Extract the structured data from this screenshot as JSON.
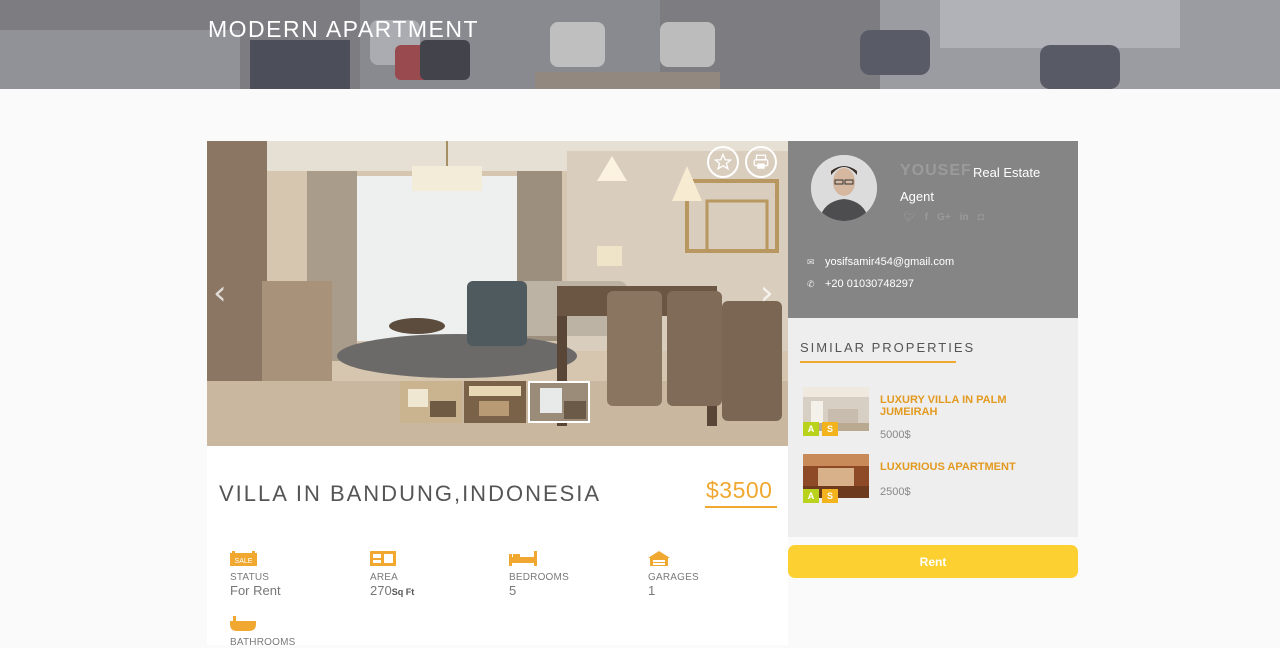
{
  "banner": {
    "title": "MODERN APARTMENT"
  },
  "gallery": {
    "prev_icon": "chevron-left-icon",
    "next_icon": "chevron-right-icon",
    "favorite_icon": "star-icon",
    "print_icon": "printer-icon",
    "thumbnail_count": 3,
    "active_thumbnail": 3
  },
  "property": {
    "title": "VILLA IN BANDUNG,INDONESIA",
    "price": "$3500",
    "accent_color": "#f0a830"
  },
  "features": [
    {
      "icon": "sale-tag-icon",
      "icon_text": "SALE",
      "label": "STATUS",
      "value": "For Rent",
      "unit": ""
    },
    {
      "icon": "area-icon",
      "icon_text": "",
      "label": "AREA",
      "value": "270",
      "unit": "Sq Ft"
    },
    {
      "icon": "bed-icon",
      "icon_text": "",
      "label": "BEDROOMS",
      "value": "5",
      "unit": ""
    },
    {
      "icon": "garage-icon",
      "icon_text": "",
      "label": "GARAGES",
      "value": "1",
      "unit": ""
    },
    {
      "icon": "bathtub-icon",
      "icon_text": "",
      "label": "BATHROOMS",
      "value": "",
      "unit": ""
    }
  ],
  "agent": {
    "name": "YOUSEF",
    "role_line1": "Real Estate",
    "role_line2": "Agent",
    "socials": [
      "twitter-icon",
      "facebook-icon",
      "google-plus-icon",
      "linkedin-icon",
      "instagram-icon"
    ],
    "email": "yosifsamir454@gmail.com",
    "phone": "+20 01030748297"
  },
  "similar": {
    "title": "SIMILAR PROPERTIES",
    "items": [
      {
        "name": "LUXURY VILLA IN PALM JUMEIRAH",
        "price": "5000$",
        "badges": [
          "A",
          "S"
        ]
      },
      {
        "name": "LUXURIOUS APARTMENT",
        "price": "2500$",
        "badges": [
          "A",
          "S"
        ]
      }
    ]
  },
  "actions": {
    "rent_label": "Rent",
    "rent_color": "#fcd030"
  }
}
